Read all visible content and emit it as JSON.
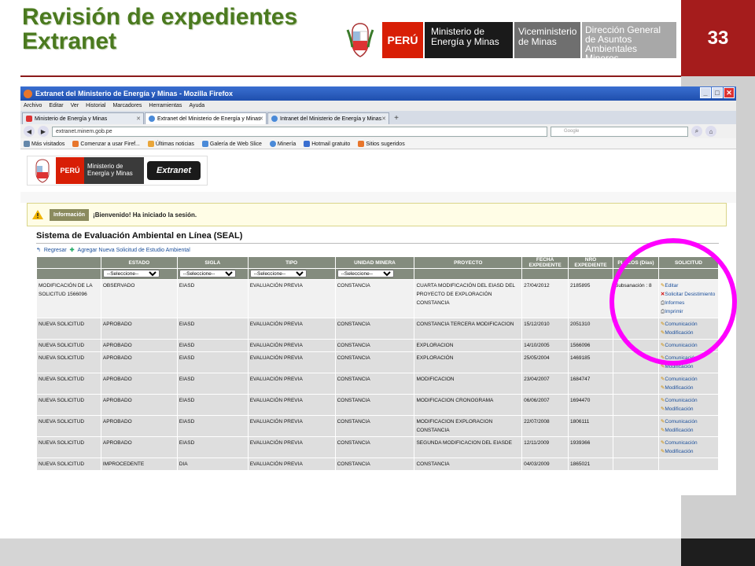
{
  "slide": {
    "title_line1": "Revisión de expedientes",
    "title_line2": "Extranet",
    "page_number": "33",
    "logo_peru": "PERÚ",
    "logo_ministry": "Ministerio de Energía y Minas",
    "logo_vice": "Viceministerio de Minas",
    "logo_dgaam": "Dirección General de Asuntos Ambientales Mineros"
  },
  "browser": {
    "window_title": "Extranet del Ministerio de Energía y Minas - Mozilla Firefox",
    "menu": [
      "Archivo",
      "Editar",
      "Ver",
      "Historial",
      "Marcadores",
      "Herramientas",
      "Ayuda"
    ],
    "tabs": [
      {
        "label": "Ministerio de Energía y Minas"
      },
      {
        "label": "Extranet del Ministerio de Energía y Minas"
      },
      {
        "label": "Intranet del Ministerio de Energía y Minas"
      }
    ],
    "url": "extranet.minem.gob.pe",
    "search_placeholder": "Google",
    "bookmarks": [
      "Más visitados",
      "Comenzar a usar Firef...",
      "Últimas noticias",
      "Galería de Web Slice",
      "Minería",
      "Hotmail gratuito",
      "Sitios sugeridos"
    ]
  },
  "page": {
    "logo_peru": "PERÚ",
    "logo_ministry": "Ministerio de Energía y Minas",
    "logo_extranet": "Extranet",
    "info_label": "Información",
    "info_text": "¡Bienvenido! Ha iniciado la sesión.",
    "seal_title": "Sistema de Evaluación Ambiental en Línea (SEAL)",
    "action_back": "Regresar",
    "action_add": "Agregar Nueva Solicitud de Estudio Ambiental",
    "columns": [
      "ESTADO",
      "SIGLA",
      "TIPO",
      "UNIDAD MINERA",
      "PROYECTO",
      "FECHA EXPEDIENTE",
      "NRO EXPEDIENTE",
      "PLAZOS (Días)",
      "SOLICITUD"
    ],
    "filter_placeholder": "--Seleccione--",
    "rows": [
      {
        "c0": "MODIFICACIÓN DE LA SOLICITUD 1566096",
        "c1": "OBSERVADO",
        "c2": "EIASD",
        "c3": "EVALUACIÓN PREVIA",
        "c4": "CONSTANCIA",
        "c5": "CUARTA MODIFICACIÓN DEL EIASD DEL PROYECTO DE EXPLORACIÓN CONSTANCIA",
        "c6": "27/04/2012",
        "c7": "2185895",
        "c8": "Subsanación : 8",
        "actions": [
          "Editar",
          "Solicitar Desistimiento",
          "Informes",
          "Imprimir"
        ]
      },
      {
        "c0": "NUEVA SOLICITUD",
        "c1": "APROBADO",
        "c2": "EIASD",
        "c3": "EVALUACIÓN PREVIA",
        "c4": "CONSTANCIA",
        "c5": "CONSTANCIA TERCERA MODIFICACION",
        "c6": "15/12/2010",
        "c7": "2051310",
        "c8": "",
        "actions": [
          "Comunicación",
          "Modificación"
        ]
      },
      {
        "c0": "NUEVA SOLICITUD",
        "c1": "APROBADO",
        "c2": "EIASD",
        "c3": "EVALUACIÓN PREVIA",
        "c4": "CONSTANCIA",
        "c5": "EXPLORACION",
        "c6": "14/10/2005",
        "c7": "1566096",
        "c8": "",
        "actions": [
          "Comunicación"
        ]
      },
      {
        "c0": "NUEVA SOLICITUD",
        "c1": "APROBADO",
        "c2": "EIASD",
        "c3": "EVALUACIÓN PREVIA",
        "c4": "CONSTANCIA",
        "c5": "EXPLORACIÓN",
        "c6": "25/05/2004",
        "c7": "1469185",
        "c8": "",
        "actions": [
          "Comunicación",
          "Modificación"
        ]
      },
      {
        "c0": "NUEVA SOLICITUD",
        "c1": "APROBADO",
        "c2": "EIASD",
        "c3": "EVALUACIÓN PREVIA",
        "c4": "CONSTANCIA",
        "c5": "MODIFICACION",
        "c6": "23/04/2007",
        "c7": "1684747",
        "c8": "",
        "actions": [
          "Comunicación",
          "Modificación"
        ]
      },
      {
        "c0": "NUEVA SOLICITUD",
        "c1": "APROBADO",
        "c2": "EIASD",
        "c3": "EVALUACIÓN PREVIA",
        "c4": "CONSTANCIA",
        "c5": "MODIFICACION CRONOGRAMA",
        "c6": "06/06/2007",
        "c7": "1694470",
        "c8": "",
        "actions": [
          "Comunicación",
          "Modificación"
        ]
      },
      {
        "c0": "NUEVA SOLICITUD",
        "c1": "APROBADO",
        "c2": "EIASD",
        "c3": "EVALUACIÓN PREVIA",
        "c4": "CONSTANCIA",
        "c5": "MODIFICACION EXPLORACION CONSTANCIA",
        "c6": "22/07/2008",
        "c7": "1806111",
        "c8": "",
        "actions": [
          "Comunicación",
          "Modificación"
        ]
      },
      {
        "c0": "NUEVA SOLICITUD",
        "c1": "APROBADO",
        "c2": "EIASD",
        "c3": "EVALUACIÓN PREVIA",
        "c4": "CONSTANCIA",
        "c5": "SEGUNDA MODIFICACION DEL EIASDE",
        "c6": "12/11/2009",
        "c7": "1939366",
        "c8": "",
        "actions": [
          "Comunicación",
          "Modificación"
        ]
      },
      {
        "c0": "NUEVA SOLICITUD",
        "c1": "IMPROCEDENTE",
        "c2": "DIA",
        "c3": "EVALUACIÓN PREVIA",
        "c4": "CONSTANCIA",
        "c5": "CONSTANCIA",
        "c6": "04/03/2009",
        "c7": "1865021",
        "c8": "",
        "actions": []
      }
    ]
  }
}
